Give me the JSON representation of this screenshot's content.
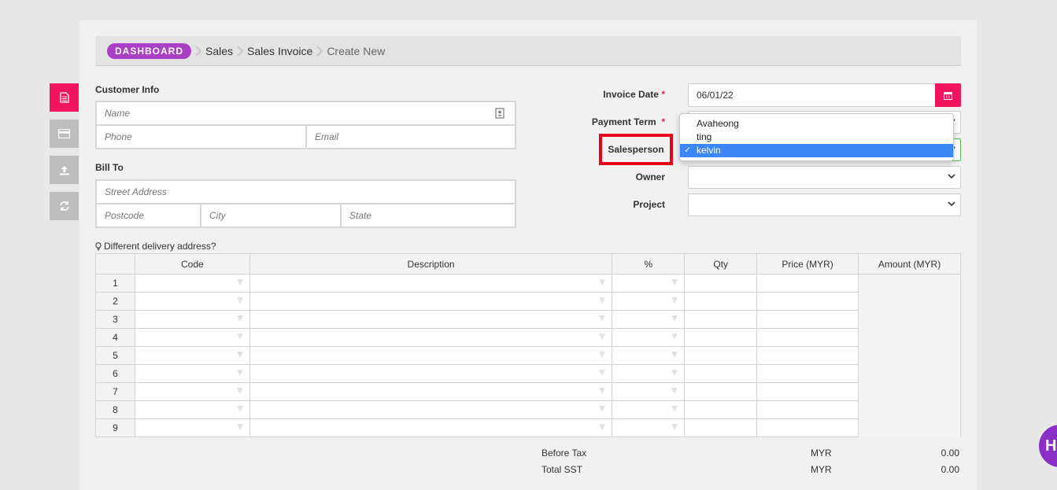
{
  "breadcrumb": {
    "dashboard": "DASHBOARD",
    "items": [
      "Sales",
      "Sales Invoice",
      "Create New"
    ]
  },
  "sidebar": {
    "icons": [
      "document-icon",
      "credit-card-icon",
      "upload-icon",
      "refresh-icon"
    ],
    "active_index": 0
  },
  "customer": {
    "section_label": "Customer Info",
    "name_placeholder": "Name",
    "phone_placeholder": "Phone",
    "email_placeholder": "Email"
  },
  "bill_to": {
    "section_label": "Bill To",
    "street_placeholder": "Street Address",
    "postcode_placeholder": "Postcode",
    "city_placeholder": "City",
    "state_placeholder": "State"
  },
  "form": {
    "invoice_date_label": "Invoice Date",
    "invoice_date_value": "06/01/22",
    "payment_term_label": "Payment Term",
    "salesperson_label": "Salesperson",
    "owner_label": "Owner",
    "project_label": "Project",
    "required_mark": "*"
  },
  "salesperson_dropdown": {
    "options": [
      "Avaheong",
      "ting",
      "kelvin"
    ],
    "selected": "kelvin",
    "check_mark": "✓"
  },
  "delivery_link": "Different delivery address?",
  "table": {
    "headers": [
      "",
      "Code",
      "Description",
      "%",
      "Qty",
      "Price (MYR)",
      "Amount (MYR)"
    ],
    "row_numbers": [
      "1",
      "2",
      "3",
      "4",
      "5",
      "6",
      "7",
      "8",
      "9"
    ]
  },
  "totals": [
    {
      "label": "Before Tax",
      "currency": "MYR",
      "value": "0.00"
    },
    {
      "label": "Total SST",
      "currency": "MYR",
      "value": "0.00"
    }
  ],
  "help_bubble": "He",
  "colors": {
    "accent": "#f0155c",
    "dashboard_badge": "#a83fc4",
    "highlight_box": "#e6001c",
    "dropdown_selected": "#3b87f6"
  }
}
